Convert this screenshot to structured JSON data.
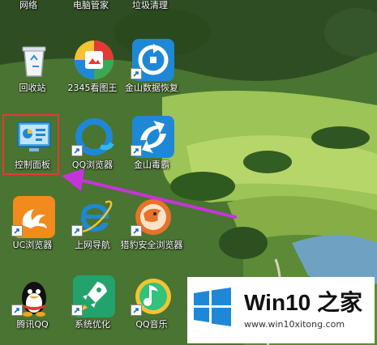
{
  "top_row": [
    "网络",
    "电脑管家",
    "垃圾清理"
  ],
  "icons": [
    {
      "label": "回收站",
      "icon": "recycle-bin-icon"
    },
    {
      "label": "2345看图王",
      "icon": "image-viewer-icon"
    },
    {
      "label": "金山数据恢复",
      "icon": "data-recovery-icon"
    },
    {
      "label": "控制面板",
      "icon": "control-panel-icon"
    },
    {
      "label": "QQ浏览器",
      "icon": "qq-browser-icon"
    },
    {
      "label": "金山毒霸",
      "icon": "antivirus-icon"
    },
    {
      "label": "UC浏览器",
      "icon": "uc-browser-icon"
    },
    {
      "label": "上网导航",
      "icon": "ie-browser-icon"
    },
    {
      "label": "猎豹安全浏览器",
      "icon": "cheetah-browser-icon"
    },
    {
      "label": "腾讯QQ",
      "icon": "qq-penguin-icon"
    },
    {
      "label": "系统优化",
      "icon": "system-optimizer-icon"
    },
    {
      "label": "QQ音乐",
      "icon": "qq-music-icon"
    }
  ],
  "watermark": {
    "title": "Win10 之家",
    "url": "www.win10xitong.com"
  },
  "colors": {
    "highlight": "#e53935",
    "arrow": "#c435d8",
    "win_blue": "#1e88d6"
  }
}
